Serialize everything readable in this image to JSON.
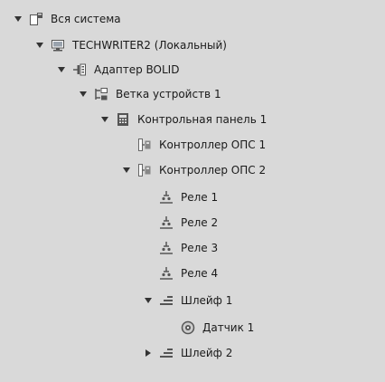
{
  "tree": {
    "items": [
      {
        "label": "Вся система",
        "icon": "system-icon",
        "toggle": "expanded"
      },
      {
        "label": "TECHWRITER2 (Локальный)",
        "icon": "computer-icon",
        "toggle": "expanded"
      },
      {
        "label": "Адаптер BOLID",
        "icon": "adapter-icon",
        "toggle": "expanded"
      },
      {
        "label": "Ветка устройств 1",
        "icon": "device-branch-icon",
        "toggle": "expanded"
      },
      {
        "label": "Контрольная панель 1",
        "icon": "control-panel-icon",
        "toggle": "expanded"
      },
      {
        "label": "Контроллер ОПС 1",
        "icon": "controller-icon",
        "toggle": "none"
      },
      {
        "label": "Контроллер ОПС 2",
        "icon": "controller-icon",
        "toggle": "expanded"
      },
      {
        "label": "Реле 1",
        "icon": "relay-icon",
        "toggle": "none"
      },
      {
        "label": "Реле 2",
        "icon": "relay-icon",
        "toggle": "none"
      },
      {
        "label": "Реле 3",
        "icon": "relay-icon",
        "toggle": "none"
      },
      {
        "label": "Реле 4",
        "icon": "relay-icon",
        "toggle": "none"
      },
      {
        "label": "Шлейф 1",
        "icon": "loop-icon",
        "toggle": "expanded"
      },
      {
        "label": "Датчик 1",
        "icon": "sensor-icon",
        "toggle": "none"
      },
      {
        "label": "Шлейф 2",
        "icon": "loop-icon",
        "toggle": "collapsed"
      }
    ]
  }
}
